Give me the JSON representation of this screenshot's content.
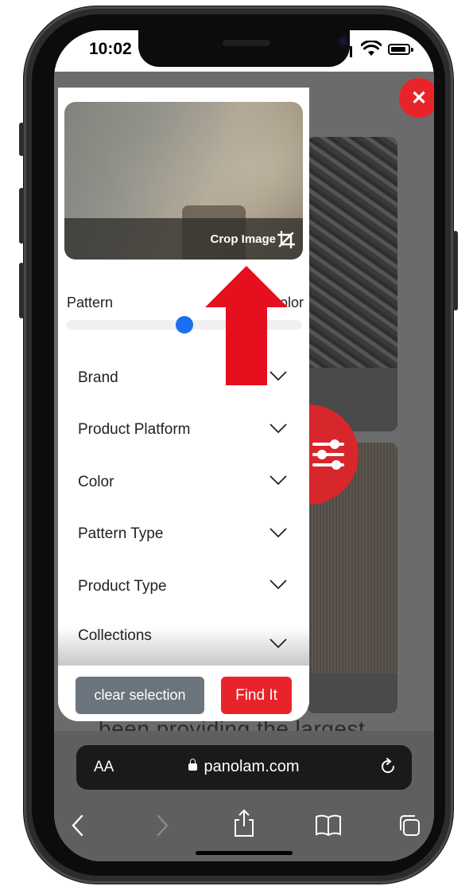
{
  "status_bar": {
    "time": "10:02"
  },
  "filter_panel": {
    "crop_label": "Crop Image",
    "slider": {
      "left_label": "Pattern",
      "right_label": "Color",
      "value_fraction": 0.5
    },
    "filters": [
      {
        "label": "Brand"
      },
      {
        "label": "Product Platform"
      },
      {
        "label": "Color"
      },
      {
        "label": "Pattern Type"
      },
      {
        "label": "Product Type"
      },
      {
        "label": "Collections"
      }
    ],
    "clear_label": "clear selection",
    "find_label": "Find It"
  },
  "background_page": {
    "text": "been providing the largest"
  },
  "safari": {
    "aa_label": "AA",
    "url": "panolam.com"
  },
  "colors": {
    "accent_red": "#e8242a",
    "slider_blue": "#1a6ff0",
    "clear_gray": "#6c757d"
  },
  "icons": [
    "close-icon",
    "filter-sliders-icon",
    "crop-icon",
    "chevron-down-icon",
    "reload-icon",
    "back-icon",
    "forward-icon",
    "share-icon",
    "bookmarks-icon",
    "tabs-icon",
    "wifi-icon",
    "battery-icon"
  ]
}
